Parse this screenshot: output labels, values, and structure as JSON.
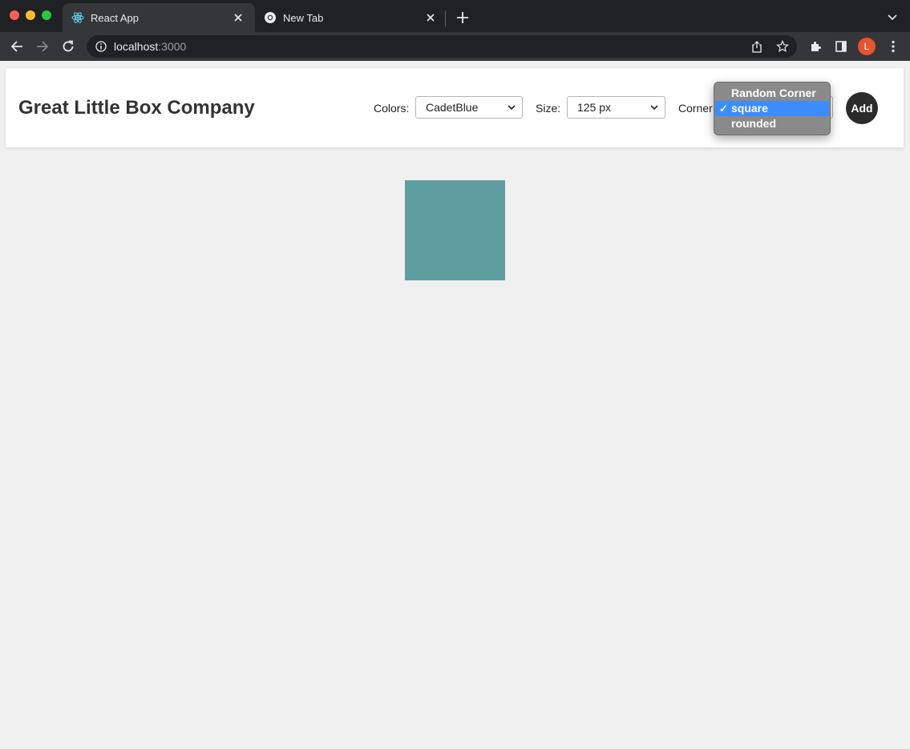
{
  "browser": {
    "tabs": [
      {
        "title": "React App",
        "active": true,
        "icon": "react-icon"
      },
      {
        "title": "New Tab",
        "active": false,
        "icon": "chrome-icon"
      }
    ],
    "url_host": "localhost",
    "url_port": ":3000",
    "profile_initial": "L"
  },
  "app": {
    "brand": "Great Little Box Company",
    "controls": {
      "colors_label": "Colors:",
      "colors_value": "CadetBlue",
      "size_label": "Size:",
      "size_value": "125 px",
      "corner_label": "Corner",
      "add_label": "Add"
    },
    "corner_dropdown": {
      "options": [
        "Random Corner",
        "square",
        "rounded"
      ],
      "selected": "square",
      "check_mark": "✓"
    },
    "boxes": [
      {
        "color": "CadetBlue",
        "hex": "#5f9ea0",
        "size": "125 px",
        "corner": "square"
      }
    ]
  },
  "colors": {
    "page_bg": "#f0f0f0",
    "highlight": "#3b8cff",
    "box": "#5f9ea0"
  }
}
